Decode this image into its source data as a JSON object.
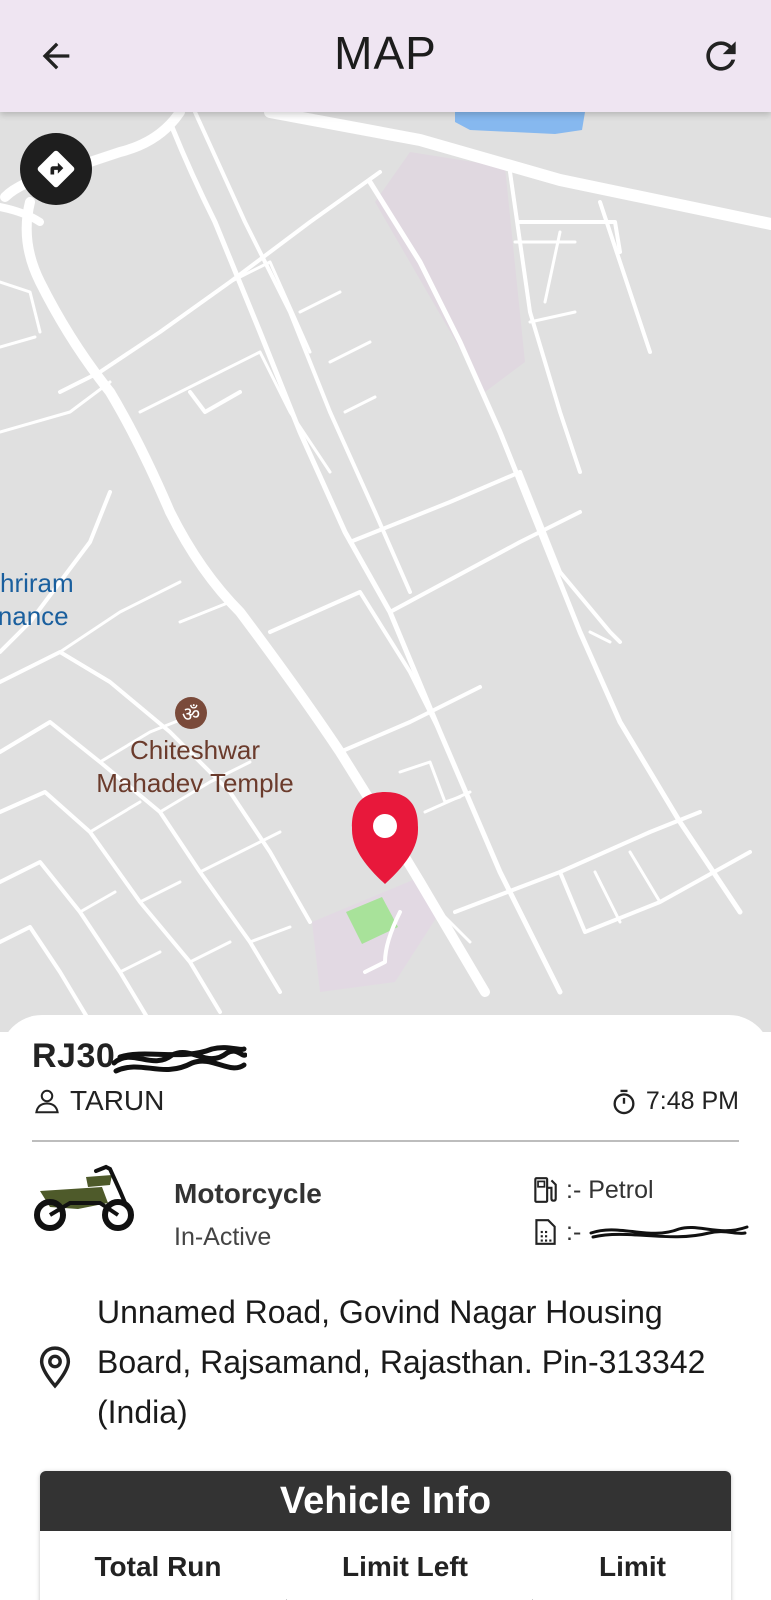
{
  "appbar": {
    "title": "MAP",
    "back_icon": "arrow-left-icon",
    "refresh_icon": "refresh-icon"
  },
  "map": {
    "directions_icon": "directions-icon",
    "poi": [
      {
        "label": "hriram",
        "label2": "inance"
      },
      {
        "label": "Chiteshwar",
        "label2": "Mahadev Temple",
        "icon": "om-temple-icon"
      }
    ],
    "marker_icon": "location-pin-icon",
    "colors": {
      "background": "#e0e0e0",
      "road": "#ffffff",
      "water": "#86b8ef",
      "pin": "#e8183b"
    }
  },
  "card": {
    "plate": "RJ30",
    "owner": "TARUN",
    "time": "7:48 PM",
    "vehicle_type": "Motorcycle",
    "vehicle_status": "In-Active",
    "fuel": ":- Petrol",
    "sim": ":-",
    "address": "Unnamed Road, Govind Nagar Housing Board, Rajsamand, Rajasthan. Pin-313342 (India)",
    "vehicle_info": {
      "title": "Vehicle Info",
      "columns": [
        "Total Run",
        "Limit Left",
        "Limit"
      ]
    }
  }
}
